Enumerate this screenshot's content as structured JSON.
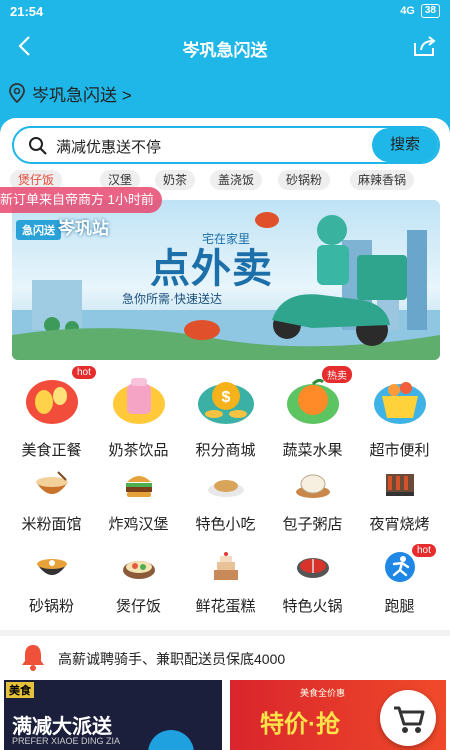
{
  "status_bar": {
    "time": "21:54",
    "signal": "4G",
    "battery": "38"
  },
  "nav": {
    "title": "岑巩急闪送"
  },
  "location": {
    "label": "岑巩急闪送 >"
  },
  "search": {
    "value": "满减优惠送不停",
    "button": "搜索"
  },
  "tags": [
    "煲仔饭",
    "汉堡",
    "奶茶",
    "盖浇饭",
    "砂锅粉",
    "麻辣香锅"
  ],
  "ticker": "新订单来自帝商方  1小时前",
  "banner": {
    "badge": "急闪送",
    "site": "岑巩站",
    "headline": "点外卖",
    "headline_small": "宅在家里",
    "slogan": "急你所需·快速送达"
  },
  "categories": [
    {
      "label": "美食正餐",
      "icon": "burger-fries-icon",
      "badge": "hot"
    },
    {
      "label": "奶茶饮品",
      "icon": "milk-tea-icon"
    },
    {
      "label": "积分商城",
      "icon": "coins-icon"
    },
    {
      "label": "蔬菜水果",
      "icon": "fruit-icon",
      "badge": "热卖"
    },
    {
      "label": "超市便利",
      "icon": "shopping-basket-icon"
    },
    {
      "label": "米粉面馆",
      "icon": "noodle-bowl-icon"
    },
    {
      "label": "炸鸡汉堡",
      "icon": "hamburger-icon"
    },
    {
      "label": "特色小吃",
      "icon": "dumpling-plate-icon"
    },
    {
      "label": "包子粥店",
      "icon": "steamed-bun-icon"
    },
    {
      "label": "夜宵烧烤",
      "icon": "barbecue-skewer-icon"
    },
    {
      "label": "砂锅粉",
      "icon": "clay-pot-icon"
    },
    {
      "label": "煲仔饭",
      "icon": "rice-bowl-icon"
    },
    {
      "label": "鲜花蛋糕",
      "icon": "cake-icon"
    },
    {
      "label": "特色火锅",
      "icon": "hotpot-icon"
    },
    {
      "label": "跑腿",
      "icon": "runner-icon",
      "badge": "hot"
    }
  ],
  "notice": {
    "text": "高薪诚聘骑手、兼职配送员保底4000"
  },
  "promos": [
    {
      "tag": "美食",
      "title": "满减大派送",
      "sub": "PREFER XIAOE DING ZIA"
    },
    {
      "tag": "美食全价惠",
      "title": "特价·抢"
    }
  ],
  "colors": {
    "primary": "#1fb6e8",
    "hot": "#e62c2c",
    "ticker": "#e84870"
  }
}
